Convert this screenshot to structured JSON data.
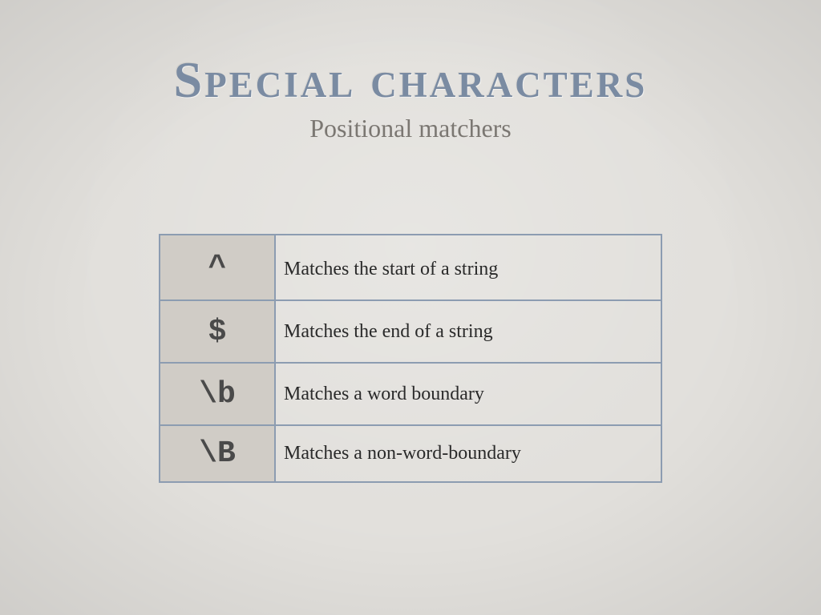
{
  "slide": {
    "title": "Special characters",
    "subtitle": "Positional matchers"
  },
  "table": {
    "rows": [
      {
        "symbol": "^",
        "description": "Matches the start of a string"
      },
      {
        "symbol": "$",
        "description": "Matches the end of a string"
      },
      {
        "symbol": "\\b",
        "description": "Matches a word boundary"
      },
      {
        "symbol": "\\B",
        "description": "Matches a non-word-boundary"
      }
    ]
  },
  "colors": {
    "background": "#e1dfdb",
    "title": "#7a8ba2",
    "subtitle": "#7b7772",
    "table_border": "#8c9cb1",
    "symbol_cell_bg": "#d0ccc6"
  }
}
